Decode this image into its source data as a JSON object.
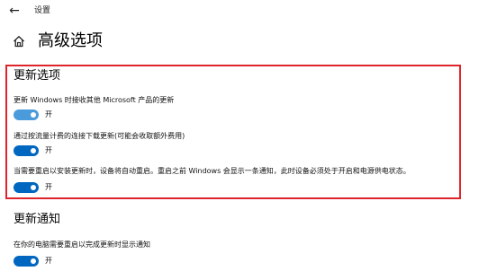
{
  "window": {
    "title": "设置"
  },
  "page": {
    "title": "高级选项"
  },
  "sections": {
    "update_options": {
      "title": "更新选项",
      "items": [
        {
          "label": "更新 Windows 时接收其他 Microsoft 产品的更新",
          "state": "开"
        },
        {
          "label": "通过按流量计费的连接下载更新(可能会收取额外费用)",
          "state": "开"
        },
        {
          "label": "当需要重启以安装更新时，设备将自动重启。重启之前 Windows 会显示一条通知，此时设备必须处于开启和电源供电状态。",
          "state": "开"
        }
      ]
    },
    "update_notifications": {
      "title": "更新通知",
      "items": [
        {
          "label": "在你的电脑需要重启以完成更新时显示通知",
          "state": "开"
        }
      ]
    }
  },
  "icons": {
    "back": "back-arrow-icon",
    "home": "home-icon"
  },
  "colors": {
    "accent": "#0067c0",
    "accent_light": "#4a9bdb",
    "highlight": "#e0242b"
  }
}
